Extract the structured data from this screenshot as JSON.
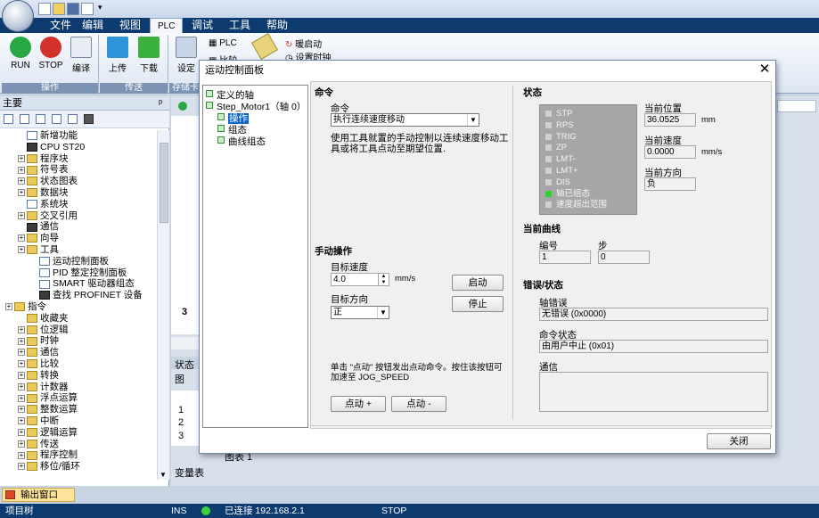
{
  "quick_access": {
    "customize": "▾"
  },
  "tabs": [
    "文件",
    "编辑",
    "视图",
    "PLC",
    "调试",
    "工具",
    "帮助"
  ],
  "active_tab": "PLC",
  "ribbon": {
    "run_label": "RUN",
    "stop_label": "STOP",
    "compile_label": "编译",
    "upload_label": "上传",
    "download_label": "下载",
    "settings_label": "设定",
    "plc_label": "PLC",
    "compare_label": "比较",
    "warm_start_label": "暖启动",
    "set_clock_label": "设置时钟",
    "group_operation": "操作",
    "group_transfer": "传送",
    "group_storage": "存储卡"
  },
  "left_pane": {
    "title": "主要",
    "pin": "ᵖ",
    "tree": [
      {
        "label": "新增功能",
        "indent": 1,
        "exp": false,
        "icon": "doc"
      },
      {
        "label": "CPU ST20",
        "indent": 1,
        "exp": false,
        "icon": "cpu"
      },
      {
        "label": "程序块",
        "indent": 1,
        "exp": true,
        "icon": "folder"
      },
      {
        "label": "符号表",
        "indent": 1,
        "exp": true,
        "icon": "folder"
      },
      {
        "label": "状态图表",
        "indent": 1,
        "exp": true,
        "icon": "folder"
      },
      {
        "label": "数据块",
        "indent": 1,
        "exp": true,
        "icon": "folder"
      },
      {
        "label": "系统块",
        "indent": 1,
        "exp": false,
        "icon": "doc"
      },
      {
        "label": "交叉引用",
        "indent": 1,
        "exp": true,
        "icon": "folder"
      },
      {
        "label": "通信",
        "indent": 1,
        "exp": false,
        "icon": "cpu"
      },
      {
        "label": "向导",
        "indent": 1,
        "exp": true,
        "icon": "folder"
      },
      {
        "label": "工具",
        "indent": 1,
        "exp": true,
        "icon": "folder"
      },
      {
        "label": "运动控制面板",
        "indent": 2,
        "exp": false,
        "icon": "doc"
      },
      {
        "label": "PID 整定控制面板",
        "indent": 2,
        "exp": false,
        "icon": "doc"
      },
      {
        "label": "SMART 驱动器组态",
        "indent": 2,
        "exp": false,
        "icon": "doc"
      },
      {
        "label": "查找 PROFINET 设备",
        "indent": 2,
        "exp": false,
        "icon": "cpu"
      },
      {
        "label": "指令",
        "indent": 0,
        "exp": true,
        "icon": "folder"
      },
      {
        "label": "收藏夹",
        "indent": 1,
        "exp": false,
        "icon": "folder"
      },
      {
        "label": "位逻辑",
        "indent": 1,
        "exp": true,
        "icon": "folder"
      },
      {
        "label": "时钟",
        "indent": 1,
        "exp": true,
        "icon": "folder"
      },
      {
        "label": "通信",
        "indent": 1,
        "exp": true,
        "icon": "folder"
      },
      {
        "label": "比较",
        "indent": 1,
        "exp": true,
        "icon": "folder"
      },
      {
        "label": "转换",
        "indent": 1,
        "exp": true,
        "icon": "folder"
      },
      {
        "label": "计数器",
        "indent": 1,
        "exp": true,
        "icon": "folder"
      },
      {
        "label": "浮点运算",
        "indent": 1,
        "exp": true,
        "icon": "folder"
      },
      {
        "label": "整数运算",
        "indent": 1,
        "exp": true,
        "icon": "folder"
      },
      {
        "label": "中断",
        "indent": 1,
        "exp": true,
        "icon": "folder"
      },
      {
        "label": "逻辑运算",
        "indent": 1,
        "exp": true,
        "icon": "folder"
      },
      {
        "label": "传送",
        "indent": 1,
        "exp": true,
        "icon": "folder"
      },
      {
        "label": "程序控制",
        "indent": 1,
        "exp": true,
        "icon": "folder"
      },
      {
        "label": "移位/循环",
        "indent": 1,
        "exp": true,
        "icon": "folder"
      }
    ]
  },
  "editor_bg": {
    "row3": "3",
    "status_chart_tab": "状态图",
    "rows": [
      "1",
      "2",
      "3"
    ],
    "chart_tab": "图表 1",
    "var_table": "变量表"
  },
  "dialog": {
    "title": "运动控制面板",
    "close": "✕",
    "tree": {
      "root": "定义的轴",
      "axis": "Step_Motor1（轴 0）",
      "items": [
        "操作",
        "组态",
        "曲线组态"
      ],
      "selected": "操作"
    },
    "command_section": "命令",
    "command_label": "命令",
    "command_value": "执行连续速度移动",
    "command_desc": "使用工具就置的手动控制以连续速度移动工具或将工具点动至期望位置.",
    "manual_section": "手动操作",
    "target_speed_label": "目标速度",
    "target_speed_value": "4.0",
    "speed_unit": "mm/s",
    "target_dir_label": "目标方向",
    "target_dir_value": "正",
    "start_button": "启动",
    "stop_button": "停止",
    "jog_desc": "单击 \"点动\" 按钮发出点动命令。按住该按钮可加速至 JOG_SPEED",
    "jog_plus": "点动 +",
    "jog_minus": "点动 -",
    "status_section": "状态",
    "status_items": [
      {
        "label": "STP",
        "on": false
      },
      {
        "label": "RPS",
        "on": false
      },
      {
        "label": "TRIG",
        "on": false
      },
      {
        "label": "ZP",
        "on": false
      },
      {
        "label": "LMT-",
        "on": false
      },
      {
        "label": "LMT+",
        "on": false
      },
      {
        "label": "DIS",
        "on": false
      },
      {
        "label": "轴已组态",
        "on": true
      },
      {
        "label": "速度超出范围",
        "on": false
      }
    ],
    "cur_pos_label": "当前位置",
    "cur_pos_value": "36.0525",
    "cur_pos_unit": "mm",
    "cur_speed_label": "当前速度",
    "cur_speed_value": "0.0000",
    "cur_speed_unit": "mm/s",
    "cur_dir_label": "当前方向",
    "cur_dir_value": "负",
    "curve_section": "当前曲线",
    "curve_no_label": "编号",
    "curve_no_value": "1",
    "curve_step_label": "步",
    "curve_step_value": "0",
    "error_section": "错误/状态",
    "axis_error_label": "轴错误",
    "axis_error_value": "无错误 (0x0000)",
    "cmd_status_label": "命令状态",
    "cmd_status_value": "由用户中止 (0x01)",
    "comm_label": "通信",
    "comm_value": "",
    "close_button": "关闭"
  },
  "output_window": "输出窗口",
  "statusbar": {
    "project_tree": "项目树",
    "ins": "INS",
    "connected": "已连接 192.168.2.1",
    "mode": "STOP"
  },
  "colors": {
    "accent": "#0d3b6f",
    "led_on": "#2fd12f",
    "status_box": "#a6a6a6"
  }
}
